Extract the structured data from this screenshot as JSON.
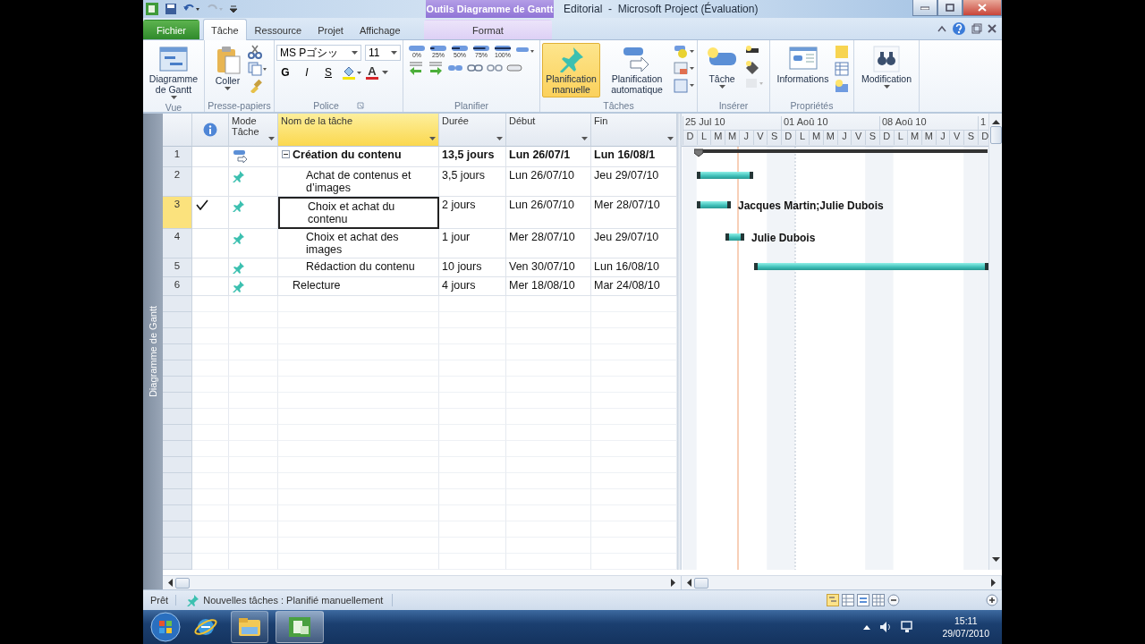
{
  "window": {
    "contextual_group": "Outils Diagramme de Gantt",
    "title": "Editorial  -  Microsoft Project (Évaluation)"
  },
  "tabs": [
    {
      "label": "Fichier",
      "kind": "file",
      "selected": false
    },
    {
      "label": "Tâche",
      "kind": "normal",
      "selected": true
    },
    {
      "label": "Ressource",
      "kind": "normal",
      "selected": false
    },
    {
      "label": "Projet",
      "kind": "normal",
      "selected": false
    },
    {
      "label": "Affichage",
      "kind": "normal",
      "selected": false
    },
    {
      "label": "Format",
      "kind": "contextual",
      "selected": false
    }
  ],
  "ribbon": [
    {
      "kind": "view",
      "label": "Vue",
      "button": "Diagramme de Gantt"
    },
    {
      "kind": "clipboard",
      "label": "Presse-papiers",
      "button": "Coller"
    },
    {
      "kind": "font",
      "label": "Police",
      "font_name": "MS Pゴシッ",
      "font_size": "11",
      "styles": [
        "G",
        "I",
        "S"
      ],
      "font_color": "A"
    },
    {
      "kind": "schedule",
      "label": "Planifier",
      "percents": [
        "0%",
        "25%",
        "50%",
        "75%",
        "100%"
      ]
    },
    {
      "kind": "tasks",
      "label": "Tâches",
      "buttons": [
        {
          "label": "Planification manuelle",
          "selected": true
        },
        {
          "label": "Planification automatique",
          "selected": false
        }
      ]
    },
    {
      "kind": "insert",
      "label": "Insérer",
      "button": "Tâche"
    },
    {
      "kind": "properties",
      "label": "Propriétés",
      "button": "Informations"
    },
    {
      "kind": "editing",
      "button": "Modification"
    }
  ],
  "side_label": "Diagramme de Gantt",
  "table": {
    "columns": [
      {
        "label": "Mode Tâche",
        "selected": false
      },
      {
        "label": "Nom de la tâche",
        "selected": true
      },
      {
        "label": "Durée",
        "selected": false
      },
      {
        "label": "Début",
        "selected": false
      },
      {
        "label": "Fin",
        "selected": false
      }
    ],
    "rows": [
      {
        "id": "1",
        "kind": "auto",
        "expanded": true,
        "completed": false,
        "selected": false,
        "name": "Création du contenu",
        "duration": "13,5 jours",
        "start": "Lun 26/07/1",
        "finish": "Lun 16/08/1",
        "children": [
          {
            "id": "2",
            "kind": "manual",
            "completed": false,
            "selected": false,
            "name": "Achat de contenus et d’images",
            "duration": "3,5 jours",
            "start": "Lun 26/07/10",
            "finish": "Jeu 29/07/10"
          },
          {
            "id": "3",
            "kind": "manual",
            "completed": true,
            "selected": true,
            "name": "Choix et achat du contenu",
            "duration": "2 jours",
            "start": "Lun 26/07/10",
            "finish": "Mer 28/07/10"
          },
          {
            "id": "4",
            "kind": "manual",
            "completed": false,
            "selected": false,
            "name": "Choix et achat des images",
            "duration": "1 jour",
            "start": "Mer 28/07/10",
            "finish": "Jeu 29/07/10"
          },
          {
            "id": "5",
            "kind": "manual",
            "completed": false,
            "selected": false,
            "name": "Rédaction du contenu",
            "duration": "10 jours",
            "start": "Ven 30/07/10",
            "finish": "Lun 16/08/10"
          }
        ]
      },
      {
        "id": "6",
        "kind": "manual",
        "completed": false,
        "selected": false,
        "name": "Relecture",
        "duration": "4 jours",
        "start": "Mer 18/08/10",
        "finish": "Mar 24/08/10"
      }
    ]
  },
  "gantt": {
    "weeks": [
      "25 Jul 10",
      "01 Aoû 10",
      "08 Aoû 10",
      "1"
    ],
    "days": [
      "D",
      "L",
      "M",
      "M",
      "J",
      "V",
      "S",
      "D",
      "L",
      "M",
      "M",
      "J",
      "V",
      "S",
      "D",
      "L",
      "M",
      "M",
      "J",
      "V",
      "S",
      "D"
    ],
    "bars": [
      {
        "kind": "summary"
      },
      {
        "kind": "task"
      },
      {
        "kind": "task",
        "resources": "Jacques Martin;Julie Dubois"
      },
      {
        "kind": "task",
        "resources": "Julie Dubois"
      },
      {
        "kind": "task"
      }
    ]
  },
  "status_bar": {
    "ready": "Prêt",
    "new_tasks": "Nouvelles tâches : Planifié manuellement"
  },
  "taskbar": {
    "time": "15:11",
    "date": "29/07/2010"
  }
}
